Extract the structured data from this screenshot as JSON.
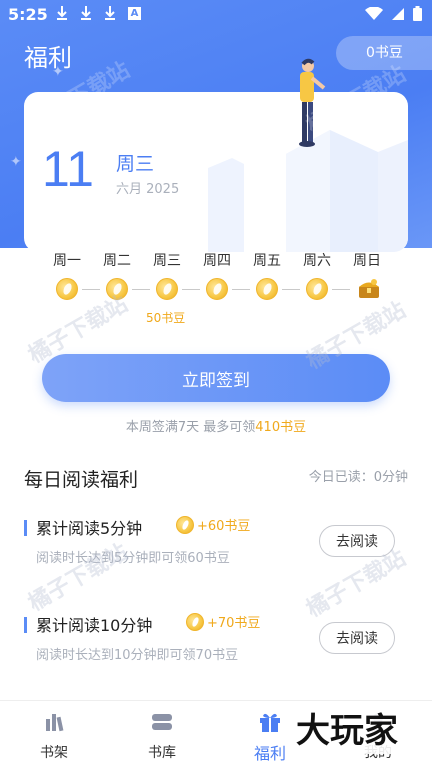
{
  "status_bar": {
    "time": "5:25",
    "notification_icons": [
      "download-icon",
      "download-icon",
      "download-icon",
      "a-icon"
    ],
    "notification_badge_letter": "A",
    "right_icons": [
      "wifi-icon",
      "signal-icon",
      "battery-icon"
    ]
  },
  "header": {
    "title": "福利",
    "beans_balance": "0书豆"
  },
  "calendar": {
    "day": "11",
    "weekday": "周三",
    "month_year": "六月 2025"
  },
  "week": {
    "days": [
      "周一",
      "周二",
      "周三",
      "周四",
      "周五",
      "周六",
      "周日"
    ],
    "day3_reward": "50书豆"
  },
  "signin": {
    "button_label": "立即签到",
    "hint_prefix": "本周签满7天 最多可领",
    "hint_amount": "410书豆"
  },
  "daily_reading": {
    "title": "每日阅读福利",
    "today_read": "今日已读：0分钟",
    "tasks": [
      {
        "name": "累计阅读5分钟",
        "reward": "+60书豆",
        "description": "阅读时长达到5分钟即可领60书豆",
        "button": "去阅读"
      },
      {
        "name": "累计阅读10分钟",
        "reward": "+70书豆",
        "description": "阅读时长达到10分钟即可领70书豆",
        "button": "去阅读"
      }
    ]
  },
  "watermark": "橘子下载站",
  "bottom_nav": {
    "items": [
      {
        "label": "书架",
        "icon": "bookshelf-icon"
      },
      {
        "label": "书库",
        "icon": "library-icon"
      },
      {
        "label": "福利",
        "icon": "gift-icon"
      },
      {
        "label": "我的",
        "icon": "profile-icon"
      }
    ],
    "active_index": 2
  },
  "brand_logo": "大玩家",
  "colors": {
    "primary": "#4b7ef3",
    "accent": "#f0a91c",
    "muted": "#aab0bb"
  }
}
